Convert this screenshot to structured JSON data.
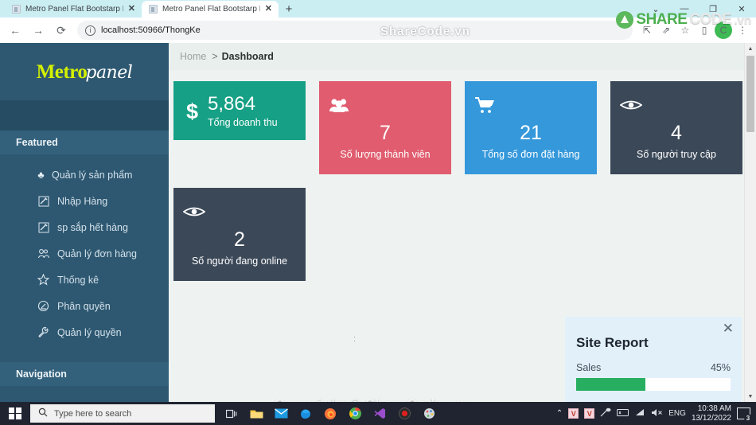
{
  "browser": {
    "tabs": [
      {
        "title": "Metro Panel Flat Bootstarp Respo",
        "close": "✕",
        "active": false
      },
      {
        "title": "Metro Panel Flat Bootstarp Respo",
        "close": "✕",
        "active": true
      }
    ],
    "new_tab_label": "+",
    "window_controls": {
      "minimize": "—",
      "maximize": "❐",
      "close": "✕",
      "chevron": "⌄"
    },
    "nav": {
      "back": "←",
      "forward": "→",
      "reload": "⟳",
      "info_icon": "ⓘ",
      "url": "localhost:50966/ThongKe"
    },
    "nav_right": {
      "share": "⇱",
      "bookmark": "☆",
      "extension": "▯",
      "menu": "⋮",
      "profile": "C"
    }
  },
  "watermarks": {
    "top": "ShareCode.vn",
    "bottom": "Copyright © ShareCode.vn",
    "logo_share": "SHARE",
    "logo_code": "CODE",
    "logo_vn": ".vn"
  },
  "sidebar": {
    "logo_main": "Metro",
    "logo_script": "panel",
    "featured_header": "Featured",
    "navigation_header": "Navigation",
    "items": [
      {
        "label": "Quản lý sản phẩm",
        "icon": "♣"
      },
      {
        "label": "Nhập Hàng",
        "icon": "✎"
      },
      {
        "label": "sp sắp hết hàng",
        "icon": "✎"
      },
      {
        "label": "Quản lý đơn hàng",
        "icon": "👥"
      },
      {
        "label": "Thống kê",
        "icon": "☆"
      },
      {
        "label": "Phân quyền",
        "icon": "◔"
      },
      {
        "label": "Quản lý quyền",
        "icon": "🔧"
      }
    ]
  },
  "breadcrumb": {
    "home": "Home",
    "separator": ">",
    "current": "Dashboard"
  },
  "tiles": [
    {
      "icon": "$",
      "value": "5,864",
      "label": "Tổng doanh thu",
      "color": "#16a085",
      "style": "inline"
    },
    {
      "icon": "👥",
      "value": "7",
      "label": "Số lượng thành viên",
      "color": "#e05c6e",
      "style": "tall"
    },
    {
      "icon": "🛒",
      "value": "21",
      "label": "Tổng số đơn đặt hàng",
      "color": "#3498db",
      "style": "tall"
    },
    {
      "icon": "👁",
      "value": "4",
      "label": "Số người truy cập",
      "color": "#3b4858",
      "style": "tall"
    },
    {
      "icon": "👁",
      "value": "2",
      "label": "Số người đang online",
      "color": "#3b4858",
      "style": "tall"
    }
  ],
  "site_report": {
    "title": "Site Report",
    "close": "✕",
    "metric_label": "Sales",
    "metric_value": "45%",
    "progress_percent": 45,
    "bar_color": "#27ae60"
  },
  "taskbar": {
    "search_placeholder": "Type here to search",
    "search_icon": "🔍",
    "task_view": "❐",
    "language": "ENG",
    "time": "10:38 AM",
    "date": "13/12/2022",
    "notification_count": "3",
    "tray_v1": "V",
    "tray_v2": "V",
    "chevron": "⌃"
  },
  "chart_data": {
    "type": "bar",
    "title": "Site Report",
    "categories": [
      "Sales"
    ],
    "values": [
      45
    ],
    "ylim": [
      0,
      100
    ],
    "ylabel": "%",
    "xlabel": ""
  }
}
